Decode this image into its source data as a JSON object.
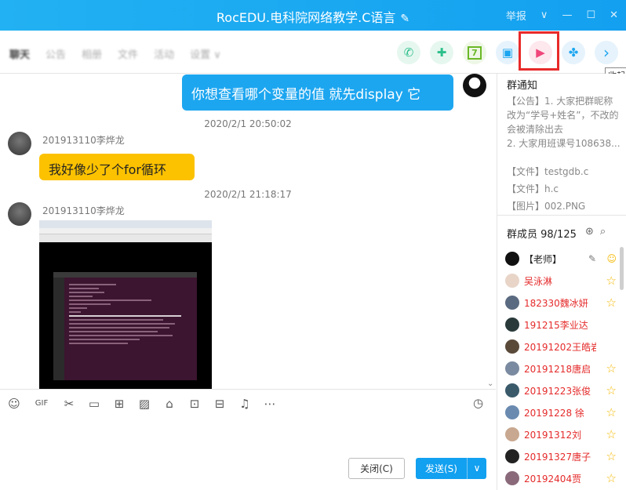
{
  "window": {
    "title": "RocEDU.电科院网络教学.C语言",
    "report": "举报",
    "min": "—",
    "max": "☐",
    "close": "✕",
    "chevron": "∨"
  },
  "tabs": [
    "聊天",
    "公告",
    "相册",
    "文件",
    "活动",
    "设置 ∨"
  ],
  "toolbar_buttons": [
    {
      "name": "phone",
      "glyph": "✆",
      "color": "#2bbf8a"
    },
    {
      "name": "add-chat",
      "glyph": "✚",
      "color": "#2bbf8a"
    },
    {
      "name": "calendar",
      "glyph": "7",
      "color": "#6ab826"
    },
    {
      "name": "image",
      "glyph": "▣",
      "color": "#1da6f0"
    },
    {
      "name": "video",
      "glyph": "▶",
      "color": "#f0467a"
    },
    {
      "name": "apps",
      "glyph": "✤",
      "color": "#1da6f0"
    },
    {
      "name": "collapse",
      "glyph": "›",
      "color": "#1da6f0"
    }
  ],
  "tooltip": "收起",
  "messages": {
    "m1": {
      "text": "你想查看哪个变量的值 就先display 它"
    },
    "t1": "2020/2/1 20:50:02",
    "m2": {
      "sender": "201913110李烨龙",
      "text": "我好像少了个for循环"
    },
    "t2": "2020/2/1 21:18:17",
    "m3": {
      "sender": "201913110李烨龙"
    }
  },
  "input_toolbar": [
    "☺",
    "GIF",
    "✂",
    "▭",
    "⊞",
    "▨",
    "⌂",
    "⊡",
    "⊟",
    "♫",
    "⋯"
  ],
  "buttons": {
    "close": "关闭(C)",
    "send": "发送(S)",
    "send_dd": "∨"
  },
  "sidebar": {
    "notice_title": "群通知",
    "notice": [
      "【公告】1. 大家把群昵称改为“学号+姓名”，不改的会被清除出去",
      "2. 大家用班课号108638..."
    ],
    "files": [
      "【文件】testgdb.c",
      "【文件】h.c",
      "【图片】002.PNG"
    ],
    "members_title": "群成员 98/125",
    "members": [
      {
        "name": "【老师】",
        "teacher": true
      },
      {
        "name": "吴泳淋"
      },
      {
        "name": "182330魏冰妍"
      },
      {
        "name": "191215李业达"
      },
      {
        "name": "20191202王皓岩"
      },
      {
        "name": "20191218唐启"
      },
      {
        "name": "20191223张俊"
      },
      {
        "name": "20191228 徐"
      },
      {
        "name": "20191312刘"
      },
      {
        "name": "20191327唐子"
      },
      {
        "name": "20192404贾"
      }
    ]
  }
}
